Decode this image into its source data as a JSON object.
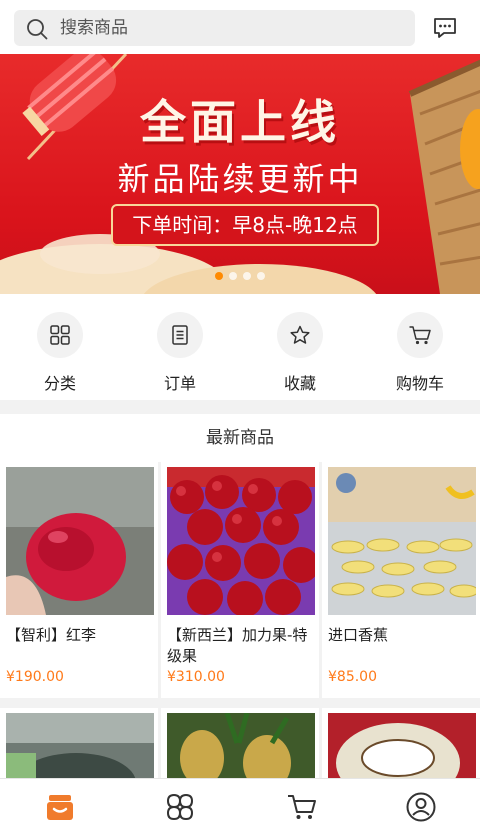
{
  "search": {
    "placeholder": "搜索商品"
  },
  "banner": {
    "title": "全面上线",
    "subtitle": "新品陆续更新中",
    "time_text": "下单时间：早8点-晚12点",
    "slides": 4,
    "active_slide": 1
  },
  "nav": {
    "items": [
      {
        "label": "分类",
        "icon": "grid-icon"
      },
      {
        "label": "订单",
        "icon": "document-icon"
      },
      {
        "label": "收藏",
        "icon": "star-icon"
      },
      {
        "label": "购物车",
        "icon": "cart-icon"
      }
    ]
  },
  "section": {
    "title": "最新商品"
  },
  "products": [
    {
      "name": "【智利】红李",
      "price": "¥190.00"
    },
    {
      "name": "【新西兰】加力果-特级果",
      "price": "¥310.00"
    },
    {
      "name": "进口香蕉",
      "price": "¥85.00"
    }
  ],
  "tabbar": {
    "items": [
      {
        "icon": "home-shop-icon",
        "active": true
      },
      {
        "icon": "category-icon",
        "active": false
      },
      {
        "icon": "cart-icon",
        "active": false
      },
      {
        "icon": "user-icon",
        "active": false
      }
    ]
  },
  "colors": {
    "accent": "#ff7a1a",
    "banner_red": "#e02020",
    "tab_active": "#f07b2c"
  }
}
